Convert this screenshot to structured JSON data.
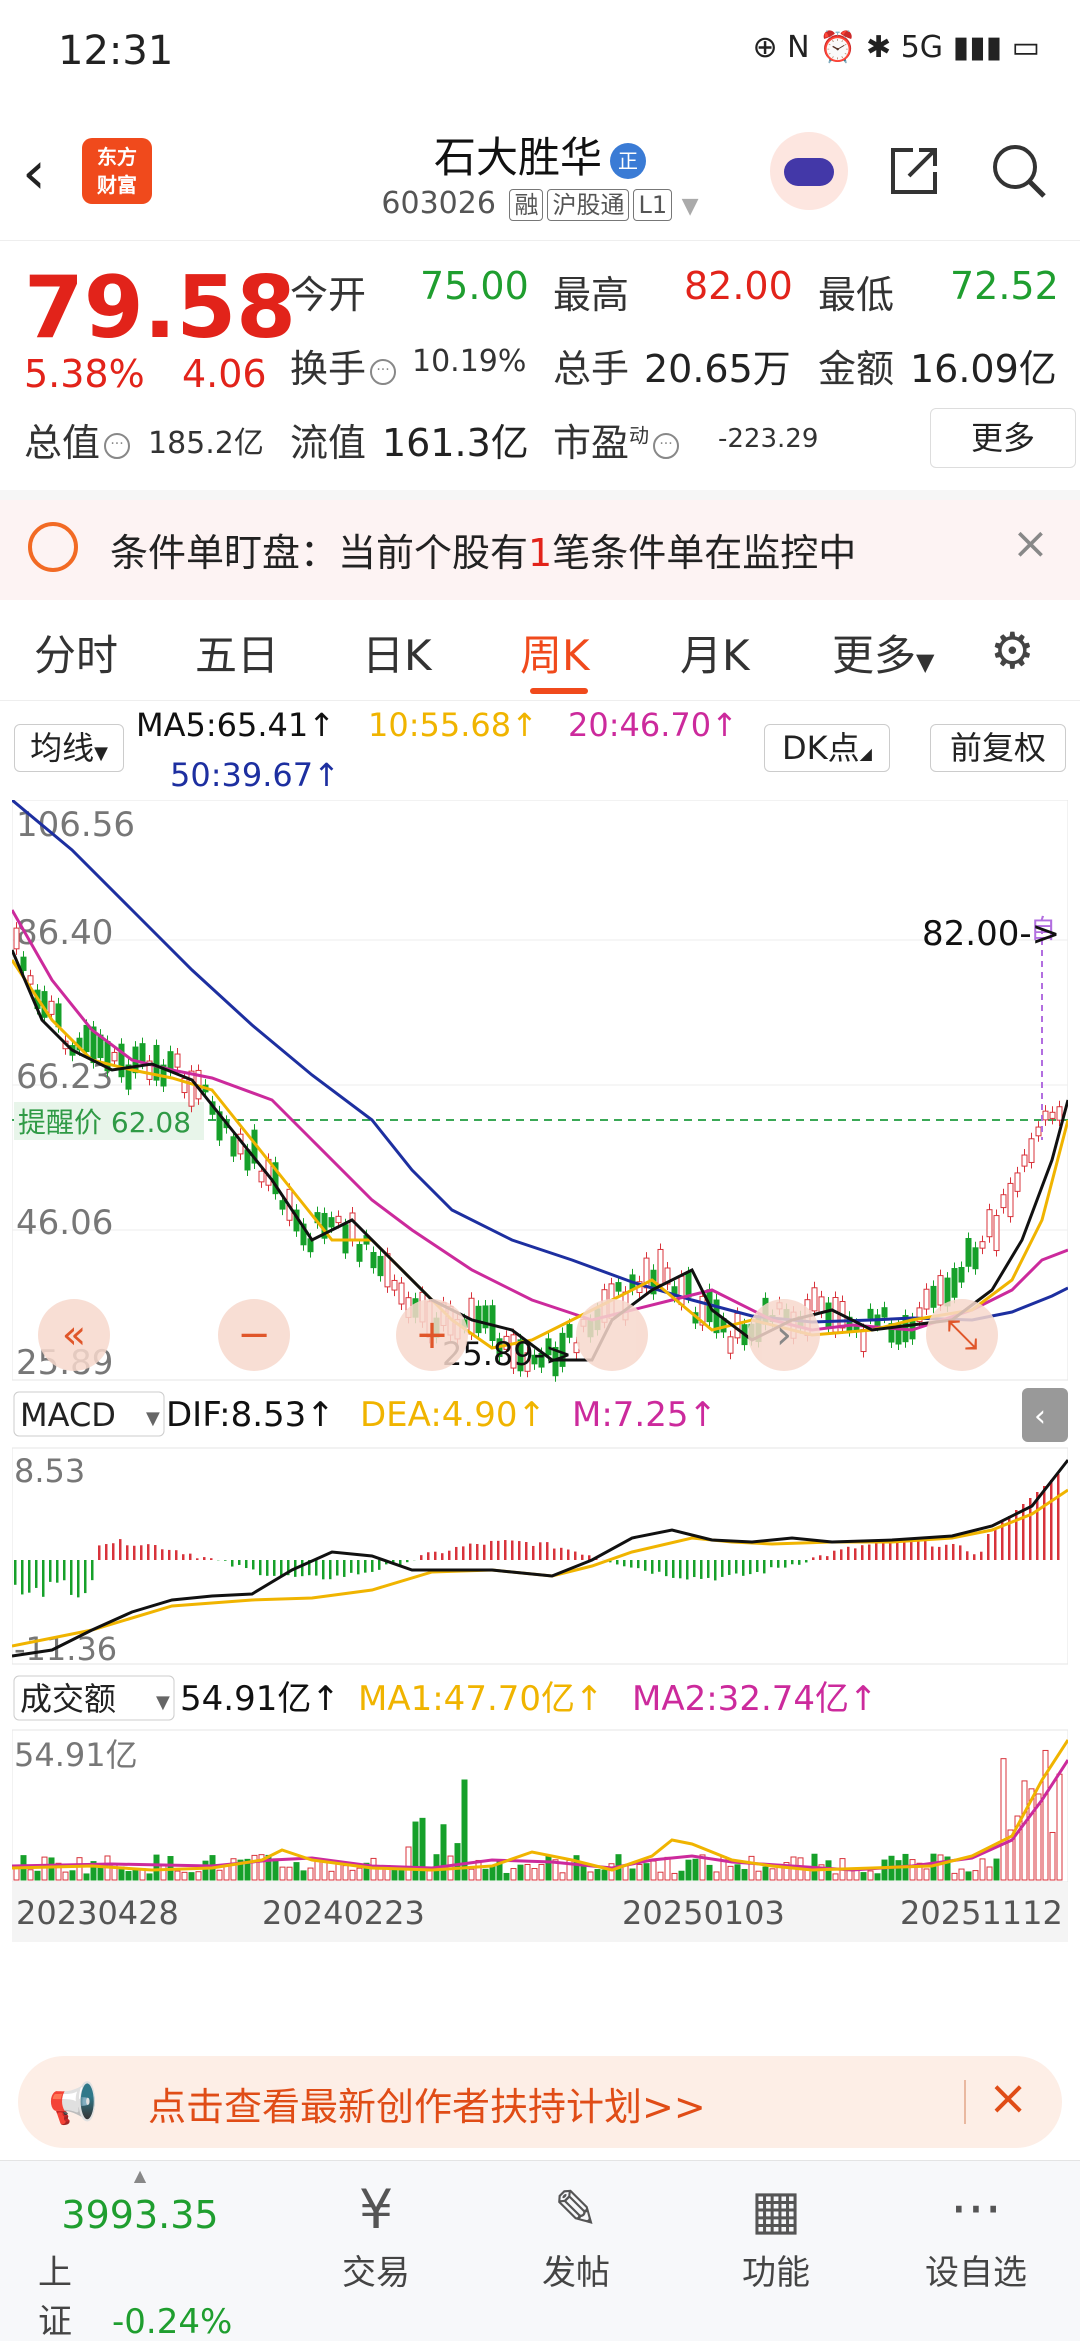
{
  "status_bar": {
    "time": "12:31",
    "icons": "⊕ N ⏰ ✱ 5G ▮▮▮ ▭"
  },
  "header": {
    "logo_text_1": "东方",
    "logo_text_2": "财富",
    "title": "石大胜华",
    "title_badge": "正",
    "code": "603026",
    "tags": [
      "融",
      "沪股通",
      "L1"
    ]
  },
  "quote": {
    "price": "79.58",
    "pct": "5.38%",
    "change": "4.06",
    "open_label": "今开",
    "open": "75.00",
    "high_label": "最高",
    "high": "82.00",
    "low_label": "最低",
    "low": "72.52",
    "turnover_label": "换手",
    "turnover": "10.19%",
    "volume_label": "总手",
    "volume": "20.65万",
    "amount_label": "金额",
    "amount": "16.09亿",
    "mcap_label": "总值",
    "mcap": "185.2亿",
    "float_label": "流值",
    "float": "161.3亿",
    "pe_label": "市盈",
    "pe_sup": "动",
    "pe": "-223.29",
    "more": "更多"
  },
  "condition_banner": {
    "prefix": "条件单盯盘：当前个股有",
    "count": "1",
    "suffix": "笔条件单在监控中"
  },
  "tabs": [
    "分时",
    "五日",
    "日K",
    "周K",
    "月K",
    "更多"
  ],
  "active_tab": "周K",
  "ma_legend": {
    "selector": "均线",
    "ma5": "MA5:65.41↑",
    "ma10": "10:55.68↑",
    "ma20": "20:46.70↑",
    "ma50": "50:39.67↑",
    "dk": "DK点",
    "adjust": "前复权"
  },
  "colors": {
    "ma5": "#111111",
    "ma10": "#f0b400",
    "ma20": "#cc2a9c",
    "ma50": "#1d2fa0",
    "up": "#d8333b",
    "down": "#16a02a"
  },
  "kline": {
    "y_labels": [
      "106.56",
      "86.40",
      "66.23",
      "46.06",
      "25.89"
    ],
    "alert_label": "提醒价 62.08",
    "high_marker": "82.00->",
    "low_marker": "25.89->",
    "self_marker": "自"
  },
  "macd": {
    "selector": "MACD",
    "dif": "DIF:8.53↑",
    "dea": "DEA:4.90↑",
    "m": "M:7.25↑",
    "top": "8.53",
    "bottom": "-11.36"
  },
  "volume": {
    "selector": "成交额",
    "value": "54.91亿↑",
    "ma1": "MA1:47.70亿↑",
    "ma2": "MA2:32.74亿↑",
    "top": "54.91亿"
  },
  "dates": [
    "20230428",
    "20240223",
    "20250103",
    "20251112"
  ],
  "promo": {
    "text": "点击查看最新创作者扶持计划>>"
  },
  "nav": {
    "index_value": "3993.35",
    "index_name": "上证",
    "index_change": "-0.24%",
    "items": [
      {
        "icon": "¥",
        "label": "交易"
      },
      {
        "icon": "✎",
        "label": "发帖"
      },
      {
        "icon": "▦",
        "label": "功能"
      },
      {
        "icon": "···",
        "label": "设自选"
      }
    ]
  }
}
